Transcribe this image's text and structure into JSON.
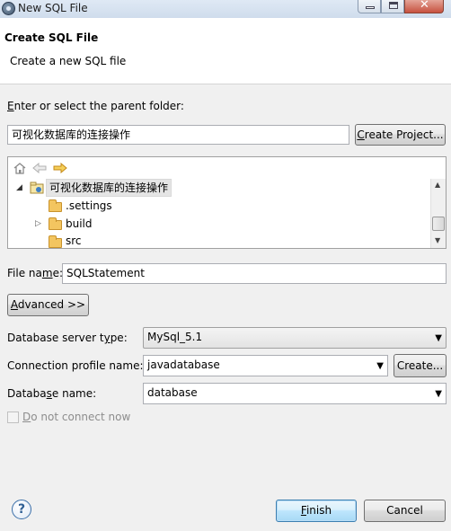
{
  "window": {
    "title": "New SQL File"
  },
  "header": {
    "title": "Create SQL File",
    "subtitle": "Create a new SQL file"
  },
  "parent_folder": {
    "label": "Enter or select the parent folder:",
    "label_mnemonic": "E",
    "label_rest": "nter or select the parent folder:",
    "value": "可视化数据库的连接操作",
    "create_project_label": "Create Project...",
    "create_project_mnemonic": "C",
    "create_project_rest": "reate Project..."
  },
  "tree": {
    "toolbar_icons": [
      "home-icon",
      "back-arrow-icon",
      "forward-arrow-icon"
    ],
    "items": [
      {
        "label": "可视化数据库的连接操作",
        "icon": "project-icon",
        "expanded": true,
        "selected": true,
        "level": 0
      },
      {
        "label": ".settings",
        "icon": "folder-icon",
        "expandable": false,
        "level": 1
      },
      {
        "label": "build",
        "icon": "folder-icon",
        "expandable": true,
        "level": 1
      },
      {
        "label": "src",
        "icon": "folder-icon",
        "expandable": false,
        "level": 1
      }
    ]
  },
  "file_name": {
    "label_pre": "File na",
    "label_mnemonic": "m",
    "label_post": "e:",
    "value": "SQLStatement"
  },
  "advanced": {
    "label_mnemonic": "A",
    "label_rest": "dvanced >>"
  },
  "db_server_type": {
    "label_pre": "Database server t",
    "label_mnemonic": "y",
    "label_post": "pe:",
    "value": "MySql_5.1"
  },
  "connection_profile": {
    "label": "Connection profile name:",
    "value": "javadatabase",
    "create_label": "Create..."
  },
  "database_name": {
    "label_pre": "Databa",
    "label_mnemonic": "s",
    "label_post": "e name:",
    "value": "database"
  },
  "do_not_connect": {
    "label_mnemonic": "D",
    "label_rest": "o not connect now",
    "checked": false,
    "enabled": false
  },
  "footer": {
    "help_glyph": "?",
    "finish_mnemonic": "F",
    "finish_rest": "inish",
    "cancel_label": "Cancel"
  }
}
